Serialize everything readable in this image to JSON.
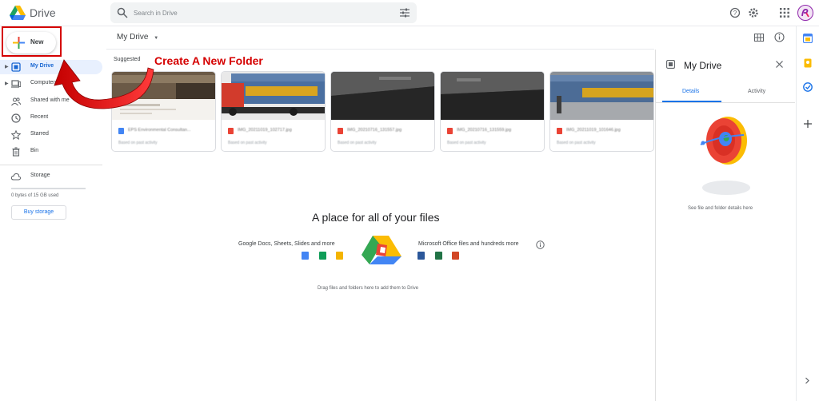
{
  "header": {
    "app_title": "Drive",
    "search_placeholder": "Search in Drive",
    "icons": [
      "drive-logo-icon",
      "search-icon",
      "filter-icon",
      "help-icon",
      "settings-icon",
      "apps-grid-icon",
      "avatar"
    ]
  },
  "sidebar": {
    "new_label": "New",
    "items": [
      {
        "label": "My Drive",
        "icon": "my-drive-icon",
        "active": true,
        "expandable": true
      },
      {
        "label": "Computers",
        "icon": "computer-icon",
        "active": false,
        "expandable": true
      },
      {
        "label": "Shared with me",
        "icon": "people-icon",
        "active": false,
        "expandable": false
      },
      {
        "label": "Recent",
        "icon": "clock-icon",
        "active": false,
        "expandable": false
      },
      {
        "label": "Starred",
        "icon": "star-icon",
        "active": false,
        "expandable": false
      },
      {
        "label": "Bin",
        "icon": "trash-icon",
        "active": false,
        "expandable": false
      }
    ],
    "storage_label": "Storage",
    "storage_used": "0 bytes of 15 GB used",
    "storage_fraction": 0,
    "buy_storage": "Buy storage"
  },
  "annotation": {
    "text": "Create A New Folder",
    "color": "#d50000"
  },
  "main": {
    "breadcrumb": "My Drive",
    "suggested_label": "Suggested",
    "cards": [
      {
        "name": "EPS Environmental Consultan...",
        "subtitle": "Based on past activity",
        "type": "doc"
      },
      {
        "name": "IMG_20211019_102717.jpg",
        "subtitle": "Based on past activity",
        "type": "image"
      },
      {
        "name": "IMG_20210716_131557.jpg",
        "subtitle": "Based on past activity",
        "type": "image"
      },
      {
        "name": "IMG_20210716_131559.jpg",
        "subtitle": "Based on past activity",
        "type": "image"
      },
      {
        "name": "IMG_20211019_101646.jpg",
        "subtitle": "Based on past activity",
        "type": "image"
      }
    ],
    "empty_title": "A place for all of your files",
    "left_caption": "Google Docs, Sheets, Slides and more",
    "right_caption": "Microsoft Office files and hundreds more",
    "drag_text": "Drag files and folders here to add them to Drive"
  },
  "details_panel": {
    "title": "My Drive",
    "tabs": [
      "Details",
      "Activity"
    ],
    "active_tab": "Details",
    "hint": "See file and folder details here"
  },
  "colors": {
    "accent": "#1a73e8",
    "active_nav_bg": "#e8f0fe",
    "annotation_red": "#d50000"
  }
}
